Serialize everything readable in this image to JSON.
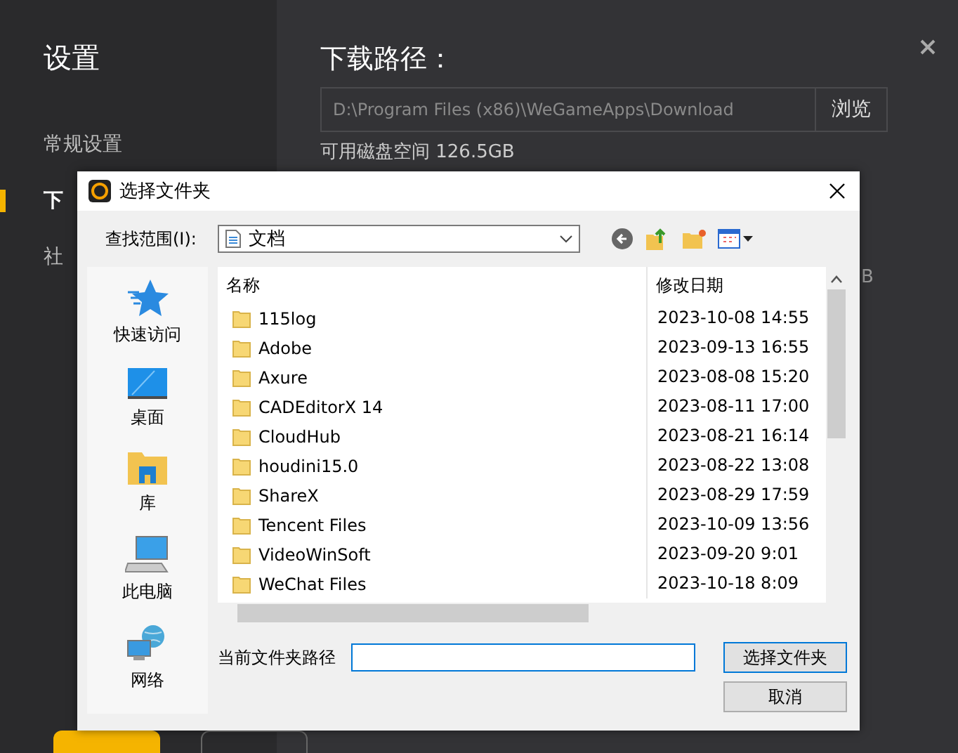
{
  "sidebar": {
    "title": "设置",
    "items": [
      {
        "label": "常规设置",
        "selected": false
      },
      {
        "label": "下",
        "selected": true
      },
      {
        "label": "社",
        "selected": false
      }
    ]
  },
  "main": {
    "heading": "下载路径：",
    "path": "D:\\Program Files (x86)\\WeGameApps\\Download",
    "browse": "浏览",
    "disk_space": "可用磁盘空间 126.5GB",
    "partial_text": "B"
  },
  "dialog": {
    "title": "选择文件夹",
    "look_in_label": "查找范围(I):",
    "location": "文档",
    "places": [
      {
        "kind": "star",
        "label": "快速访问"
      },
      {
        "kind": "desktop",
        "label": "桌面"
      },
      {
        "kind": "library",
        "label": "库"
      },
      {
        "kind": "computer",
        "label": "此电脑"
      },
      {
        "kind": "network",
        "label": "网络"
      }
    ],
    "columns": [
      "名称",
      "修改日期"
    ],
    "rows": [
      {
        "name": "115log",
        "modified": "2023-10-08 14:55"
      },
      {
        "name": "Adobe",
        "modified": "2023-09-13 16:55"
      },
      {
        "name": "Axure",
        "modified": "2023-08-08 15:20"
      },
      {
        "name": "CADEditorX 14",
        "modified": "2023-08-11 17:00"
      },
      {
        "name": "CloudHub",
        "modified": "2023-08-21 16:14"
      },
      {
        "name": "houdini15.0",
        "modified": "2023-08-22 13:08"
      },
      {
        "name": "ShareX",
        "modified": "2023-08-29 17:59"
      },
      {
        "name": "Tencent Files",
        "modified": "2023-10-09 13:56"
      },
      {
        "name": "VideoWinSoft",
        "modified": "2023-09-20 9:01"
      },
      {
        "name": "WeChat Files",
        "modified": "2023-10-18 8:09"
      }
    ],
    "path_label": "当前文件夹路径",
    "buttons": [
      "选择文件夹",
      "取消"
    ]
  }
}
